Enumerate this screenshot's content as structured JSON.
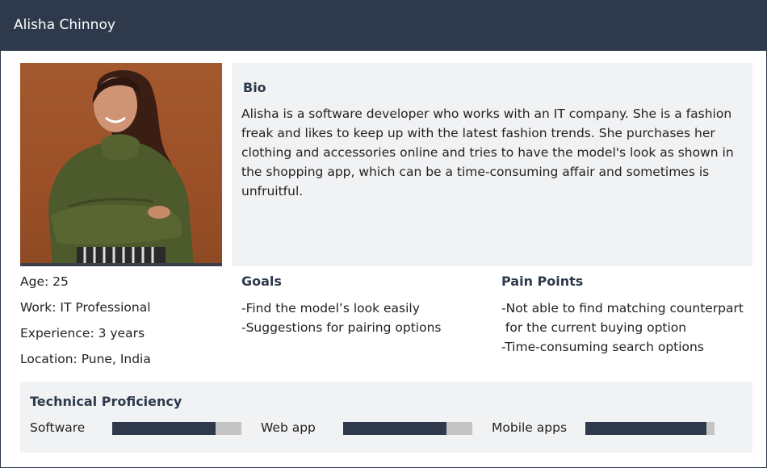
{
  "header": {
    "name": "Alisha Chinnoy"
  },
  "bio": {
    "heading": "Bio",
    "text": "Alisha is a software developer who works with an IT company. She is a fashion freak and likes to keep up with the latest fashion trends. She purchases her clothing and accessories online and tries to have the model's look as shown in the shopping app, which can be a time-consuming affair and sometimes is unfruitful."
  },
  "details": [
    "Age: 25",
    "Work: IT Professional",
    "Experience: 3 years",
    "Location: Pune, India"
  ],
  "goals": {
    "heading": "Goals",
    "items": [
      "-Find the model’s look easily",
      "-Suggestions for pairing options"
    ]
  },
  "pain_points": {
    "heading": "Pain Points",
    "items": [
      "-Not able to find matching counterpart",
      " for the current buying option",
      "-Time-consuming search options"
    ]
  },
  "technical_proficiency": {
    "heading": "Technical Proficiency",
    "skills": [
      {
        "label": "Software",
        "level": 0.8
      },
      {
        "label": "Web app",
        "level": 0.8
      },
      {
        "label": "Mobile apps",
        "level": 0.94
      }
    ]
  },
  "colors": {
    "header_bg": "#2e3a4c",
    "panel_bg": "#f1f2f4",
    "bar_fill": "#2e3a4c",
    "bar_track": "#c4c4c4"
  }
}
